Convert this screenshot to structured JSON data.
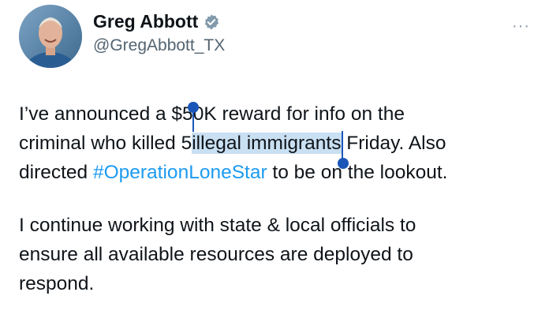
{
  "author": {
    "display_name": "Greg Abbott",
    "handle": "@GregAbbott_TX",
    "verified_badge_icon": "verified-check-icon"
  },
  "menu": {
    "more_label": "···"
  },
  "tweet": {
    "p1": {
      "a": "I’ve announced a $5",
      "b": "0K reward for info on the",
      "c": "criminal who killed 5",
      "sel": "illegal immigrants",
      "d": " Friday. Also",
      "e": "directed ",
      "hashtag": "#OperationLoneStar",
      "f": " to be on the lookout."
    },
    "p2": [
      "I continue working with state & local officials to",
      "ensure all available resources are deployed to",
      "respond."
    ]
  },
  "colors": {
    "hashtag": "#1d9bf0",
    "selection": "#c9dff2",
    "selection_handle": "#1a56b8",
    "verified": "#829aab"
  }
}
